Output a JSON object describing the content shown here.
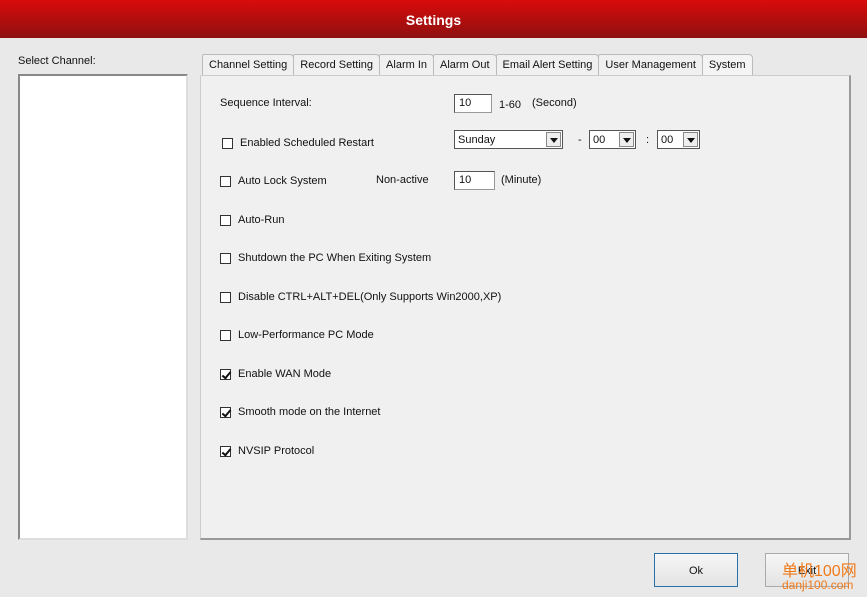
{
  "window": {
    "title": "Settings"
  },
  "sidebar": {
    "label": "Select Channel:"
  },
  "tabs": [
    {
      "label": "Channel Setting"
    },
    {
      "label": "Record Setting"
    },
    {
      "label": "Alarm In"
    },
    {
      "label": "Alarm Out"
    },
    {
      "label": "Email Alert Setting"
    },
    {
      "label": "User Management"
    },
    {
      "label": "System",
      "active": true
    }
  ],
  "system": {
    "sequence_label": "Sequence Interval:",
    "sequence_value": "10",
    "sequence_range": "1-60",
    "sequence_unit": "(Second)",
    "restart_label": "Enabled Scheduled Restart",
    "restart_checked": false,
    "restart_day": "Sunday",
    "restart_dash": "-",
    "restart_hour": "00",
    "restart_colon": ":",
    "restart_minute": "00",
    "autolock_label": "Auto Lock System",
    "autolock_checked": false,
    "nonactive_label": "Non-active",
    "nonactive_value": "10",
    "nonactive_unit": "(Minute)",
    "options": [
      {
        "label": "Auto-Run",
        "checked": false
      },
      {
        "label": "Shutdown the PC When Exiting System",
        "checked": false
      },
      {
        "label": "Disable CTRL+ALT+DEL(Only Supports Win2000,XP)",
        "checked": false
      },
      {
        "label": "Low-Performance PC Mode",
        "checked": false
      },
      {
        "label": "Enable WAN Mode",
        "checked": true
      },
      {
        "label": "Smooth mode on the Internet",
        "checked": true
      },
      {
        "label": "NVSIP Protocol",
        "checked": true
      }
    ]
  },
  "buttons": {
    "ok": "Ok",
    "exit": "Exit"
  },
  "watermark": {
    "text1": "单机100网",
    "text2": "danji100.com"
  }
}
